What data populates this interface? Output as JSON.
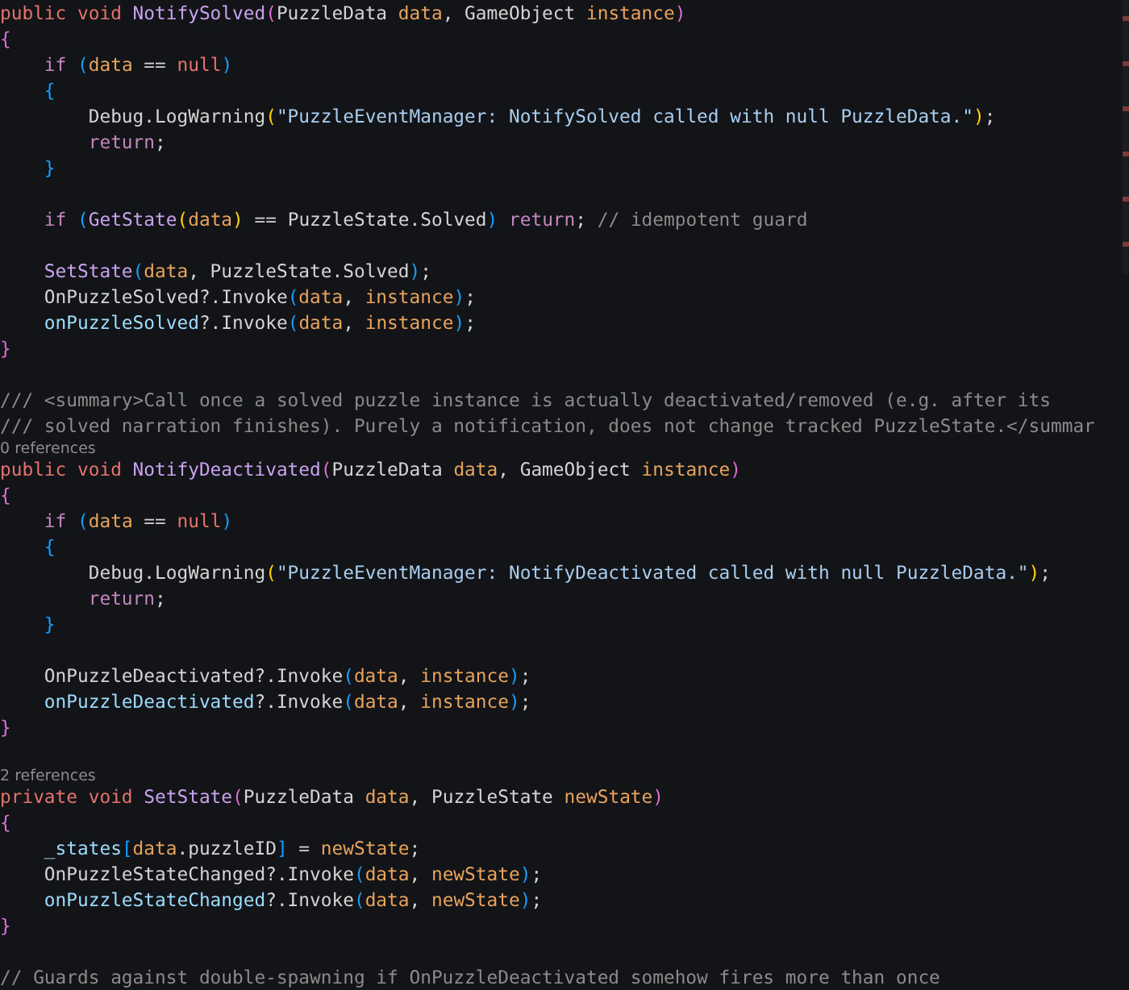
{
  "editor": {
    "lines": [
      {
        "kind": "code",
        "tokens": [
          {
            "kind": "keyword",
            "text": "public void "
          },
          {
            "kind": "function",
            "text": "NotifySolved"
          },
          {
            "kind": "bracket1",
            "text": "("
          },
          {
            "kind": "plain",
            "text": "PuzzleData "
          },
          {
            "kind": "param",
            "text": "data"
          },
          {
            "kind": "plain",
            "text": ", GameObject "
          },
          {
            "kind": "param",
            "text": "instance"
          },
          {
            "kind": "bracket1",
            "text": ")"
          }
        ]
      },
      {
        "kind": "code",
        "tokens": [
          {
            "kind": "bracket1",
            "text": "{"
          }
        ]
      },
      {
        "kind": "code",
        "tokens": [
          {
            "kind": "control",
            "text": "    if "
          },
          {
            "kind": "bracket2",
            "text": "("
          },
          {
            "kind": "param",
            "text": "data"
          },
          {
            "kind": "plain",
            "text": " == "
          },
          {
            "kind": "keyword",
            "text": "null"
          },
          {
            "kind": "bracket2",
            "text": ")"
          }
        ]
      },
      {
        "kind": "code",
        "tokens": [
          {
            "kind": "bracket2",
            "text": "    {"
          }
        ]
      },
      {
        "kind": "code",
        "tokens": [
          {
            "kind": "plain",
            "text": "        Debug.LogWarning"
          },
          {
            "kind": "bracket3",
            "text": "("
          },
          {
            "kind": "string",
            "text": "\"PuzzleEventManager: NotifySolved called with null PuzzleData.\""
          },
          {
            "kind": "bracket3",
            "text": ")"
          },
          {
            "kind": "plain",
            "text": ";"
          }
        ]
      },
      {
        "kind": "code",
        "tokens": [
          {
            "kind": "control",
            "text": "        return"
          },
          {
            "kind": "plain",
            "text": ";"
          }
        ]
      },
      {
        "kind": "code",
        "tokens": [
          {
            "kind": "bracket2",
            "text": "    }"
          }
        ]
      },
      {
        "kind": "blank"
      },
      {
        "kind": "code",
        "tokens": [
          {
            "kind": "control",
            "text": "    if "
          },
          {
            "kind": "bracket2",
            "text": "("
          },
          {
            "kind": "function",
            "text": "GetState"
          },
          {
            "kind": "bracket3",
            "text": "("
          },
          {
            "kind": "param",
            "text": "data"
          },
          {
            "kind": "bracket3",
            "text": ")"
          },
          {
            "kind": "plain",
            "text": " == PuzzleState.Solved"
          },
          {
            "kind": "bracket2",
            "text": ")"
          },
          {
            "kind": "control",
            "text": " return"
          },
          {
            "kind": "plain",
            "text": "; "
          },
          {
            "kind": "comment",
            "text": "// idempotent guard"
          }
        ]
      },
      {
        "kind": "blank"
      },
      {
        "kind": "code",
        "tokens": [
          {
            "kind": "function",
            "text": "    SetState"
          },
          {
            "kind": "bracket2",
            "text": "("
          },
          {
            "kind": "param",
            "text": "data"
          },
          {
            "kind": "plain",
            "text": ", PuzzleState.Solved"
          },
          {
            "kind": "bracket2",
            "text": ")"
          },
          {
            "kind": "plain",
            "text": ";"
          }
        ]
      },
      {
        "kind": "code",
        "tokens": [
          {
            "kind": "plain",
            "text": "    OnPuzzleSolved?.Invoke"
          },
          {
            "kind": "bracket2",
            "text": "("
          },
          {
            "kind": "param",
            "text": "data"
          },
          {
            "kind": "plain",
            "text": ", "
          },
          {
            "kind": "param",
            "text": "instance"
          },
          {
            "kind": "bracket2",
            "text": ")"
          },
          {
            "kind": "plain",
            "text": ";"
          }
        ]
      },
      {
        "kind": "code",
        "tokens": [
          {
            "kind": "field",
            "text": "    onPuzzleSolved"
          },
          {
            "kind": "plain",
            "text": "?.Invoke"
          },
          {
            "kind": "bracket2",
            "text": "("
          },
          {
            "kind": "param",
            "text": "data"
          },
          {
            "kind": "plain",
            "text": ", "
          },
          {
            "kind": "param",
            "text": "instance"
          },
          {
            "kind": "bracket2",
            "text": ")"
          },
          {
            "kind": "plain",
            "text": ";"
          }
        ]
      },
      {
        "kind": "code",
        "tokens": [
          {
            "kind": "bracket1",
            "text": "}"
          }
        ]
      },
      {
        "kind": "blank"
      },
      {
        "kind": "code",
        "tokens": [
          {
            "kind": "comment",
            "text": "/// <summary>Call once a solved puzzle instance is actually deactivated/removed (e.g. after its"
          }
        ]
      },
      {
        "kind": "code",
        "tokens": [
          {
            "kind": "comment",
            "text": "/// solved narration finishes). Purely a notification, does not change tracked PuzzleState.</summar"
          }
        ]
      },
      {
        "kind": "codelens",
        "text": "0 references"
      },
      {
        "kind": "code",
        "tokens": [
          {
            "kind": "keyword",
            "text": "public void "
          },
          {
            "kind": "function",
            "text": "NotifyDeactivated"
          },
          {
            "kind": "bracket1",
            "text": "("
          },
          {
            "kind": "plain",
            "text": "PuzzleData "
          },
          {
            "kind": "param",
            "text": "data"
          },
          {
            "kind": "plain",
            "text": ", GameObject "
          },
          {
            "kind": "param",
            "text": "instance"
          },
          {
            "kind": "bracket1",
            "text": ")"
          }
        ]
      },
      {
        "kind": "code",
        "tokens": [
          {
            "kind": "bracket1",
            "text": "{"
          }
        ]
      },
      {
        "kind": "code",
        "tokens": [
          {
            "kind": "control",
            "text": "    if "
          },
          {
            "kind": "bracket2",
            "text": "("
          },
          {
            "kind": "param",
            "text": "data"
          },
          {
            "kind": "plain",
            "text": " == "
          },
          {
            "kind": "keyword",
            "text": "null"
          },
          {
            "kind": "bracket2",
            "text": ")"
          }
        ]
      },
      {
        "kind": "code",
        "tokens": [
          {
            "kind": "bracket2",
            "text": "    {"
          }
        ]
      },
      {
        "kind": "code",
        "tokens": [
          {
            "kind": "plain",
            "text": "        Debug.LogWarning"
          },
          {
            "kind": "bracket3",
            "text": "("
          },
          {
            "kind": "string",
            "text": "\"PuzzleEventManager: NotifyDeactivated called with null PuzzleData.\""
          },
          {
            "kind": "bracket3",
            "text": ")"
          },
          {
            "kind": "plain",
            "text": ";"
          }
        ]
      },
      {
        "kind": "code",
        "tokens": [
          {
            "kind": "control",
            "text": "        return"
          },
          {
            "kind": "plain",
            "text": ";"
          }
        ]
      },
      {
        "kind": "code",
        "tokens": [
          {
            "kind": "bracket2",
            "text": "    }"
          }
        ]
      },
      {
        "kind": "blank"
      },
      {
        "kind": "code",
        "tokens": [
          {
            "kind": "plain",
            "text": "    OnPuzzleDeactivated?.Invoke"
          },
          {
            "kind": "bracket2",
            "text": "("
          },
          {
            "kind": "param",
            "text": "data"
          },
          {
            "kind": "plain",
            "text": ", "
          },
          {
            "kind": "param",
            "text": "instance"
          },
          {
            "kind": "bracket2",
            "text": ")"
          },
          {
            "kind": "plain",
            "text": ";"
          }
        ]
      },
      {
        "kind": "code",
        "tokens": [
          {
            "kind": "field",
            "text": "    onPuzzleDeactivated"
          },
          {
            "kind": "plain",
            "text": "?.Invoke"
          },
          {
            "kind": "bracket2",
            "text": "("
          },
          {
            "kind": "param",
            "text": "data"
          },
          {
            "kind": "plain",
            "text": ", "
          },
          {
            "kind": "param",
            "text": "instance"
          },
          {
            "kind": "bracket2",
            "text": ")"
          },
          {
            "kind": "plain",
            "text": ";"
          }
        ]
      },
      {
        "kind": "code",
        "tokens": [
          {
            "kind": "bracket1",
            "text": "}"
          }
        ]
      },
      {
        "kind": "blank"
      },
      {
        "kind": "codelens",
        "text": "2 references"
      },
      {
        "kind": "code",
        "tokens": [
          {
            "kind": "keyword",
            "text": "private void "
          },
          {
            "kind": "function",
            "text": "SetState"
          },
          {
            "kind": "bracket1",
            "text": "("
          },
          {
            "kind": "plain",
            "text": "PuzzleData "
          },
          {
            "kind": "param",
            "text": "data"
          },
          {
            "kind": "plain",
            "text": ", PuzzleState "
          },
          {
            "kind": "param",
            "text": "newState"
          },
          {
            "kind": "bracket1",
            "text": ")"
          }
        ]
      },
      {
        "kind": "code",
        "tokens": [
          {
            "kind": "bracket1",
            "text": "{"
          }
        ]
      },
      {
        "kind": "code",
        "tokens": [
          {
            "kind": "field",
            "text": "    _states"
          },
          {
            "kind": "bracket2",
            "text": "["
          },
          {
            "kind": "param",
            "text": "data"
          },
          {
            "kind": "plain",
            "text": ".puzzleID"
          },
          {
            "kind": "bracket2",
            "text": "]"
          },
          {
            "kind": "plain",
            "text": " = "
          },
          {
            "kind": "param",
            "text": "newState"
          },
          {
            "kind": "plain",
            "text": ";"
          }
        ]
      },
      {
        "kind": "code",
        "tokens": [
          {
            "kind": "plain",
            "text": "    OnPuzzleStateChanged?.Invoke"
          },
          {
            "kind": "bracket2",
            "text": "("
          },
          {
            "kind": "param",
            "text": "data"
          },
          {
            "kind": "plain",
            "text": ", "
          },
          {
            "kind": "param",
            "text": "newState"
          },
          {
            "kind": "bracket2",
            "text": ")"
          },
          {
            "kind": "plain",
            "text": ";"
          }
        ]
      },
      {
        "kind": "code",
        "tokens": [
          {
            "kind": "field",
            "text": "    onPuzzleStateChanged"
          },
          {
            "kind": "plain",
            "text": "?.Invoke"
          },
          {
            "kind": "bracket2",
            "text": "("
          },
          {
            "kind": "param",
            "text": "data"
          },
          {
            "kind": "plain",
            "text": ", "
          },
          {
            "kind": "param",
            "text": "newState"
          },
          {
            "kind": "bracket2",
            "text": ")"
          },
          {
            "kind": "plain",
            "text": ";"
          }
        ]
      },
      {
        "kind": "code",
        "tokens": [
          {
            "kind": "bracket1",
            "text": "}"
          }
        ]
      },
      {
        "kind": "blank"
      },
      {
        "kind": "code",
        "tokens": [
          {
            "kind": "comment",
            "text": "// Guards against double-spawning if OnPuzzleDeactivated somehow fires more than once"
          }
        ]
      }
    ]
  }
}
